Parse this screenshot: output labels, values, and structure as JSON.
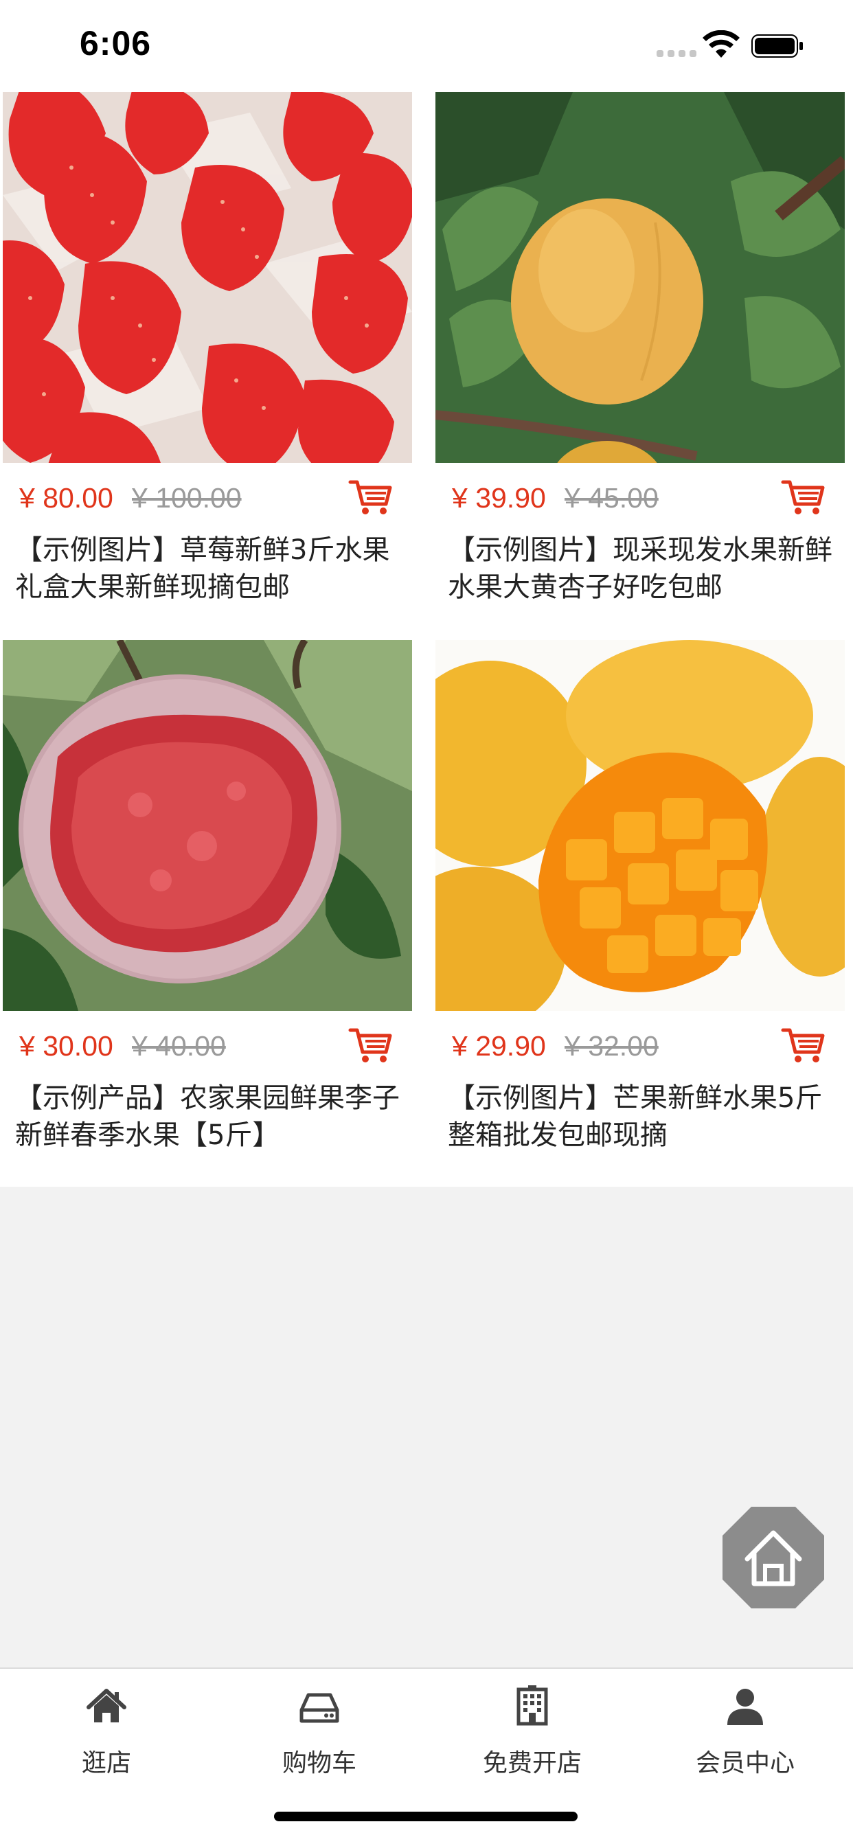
{
  "status_bar": {
    "time": "6:06"
  },
  "products": [
    {
      "image": "strawberries-photo",
      "price": "¥ 80.00",
      "original_price": "¥ 100.00",
      "title": "【示例图片】草莓新鲜3斤水果礼盒大果新鲜现摘包邮",
      "cart_icon": "cart-icon"
    },
    {
      "image": "apricot-photo",
      "price": "¥ 39.90",
      "original_price": "¥ 45.00",
      "title": "【示例图片】现采现发水果新鲜水果大黄杏子好吃包邮",
      "cart_icon": "cart-icon"
    },
    {
      "image": "plum-photo",
      "price": "¥ 30.00",
      "original_price": "¥ 40.00",
      "title": "【示例产品】农家果园鲜果李子新鲜春季水果【5斤】",
      "cart_icon": "cart-icon"
    },
    {
      "image": "mango-photo",
      "price": "¥ 29.90",
      "original_price": "¥ 32.00",
      "title": "【示例图片】芒果新鲜水果5斤整箱批发包邮现摘",
      "cart_icon": "cart-icon"
    }
  ],
  "floating_button": {
    "icon": "home-icon"
  },
  "tabbar": {
    "tabs": [
      {
        "label": "逛店",
        "icon": "home-icon"
      },
      {
        "label": "购物车",
        "icon": "drive-icon"
      },
      {
        "label": "免费开店",
        "icon": "building-icon"
      },
      {
        "label": "会员中心",
        "icon": "user-icon"
      }
    ]
  },
  "colors": {
    "price": "#e0351b",
    "old_price": "#9a9a9a",
    "background": "#f2f2f2",
    "cart": "#e0351b"
  }
}
